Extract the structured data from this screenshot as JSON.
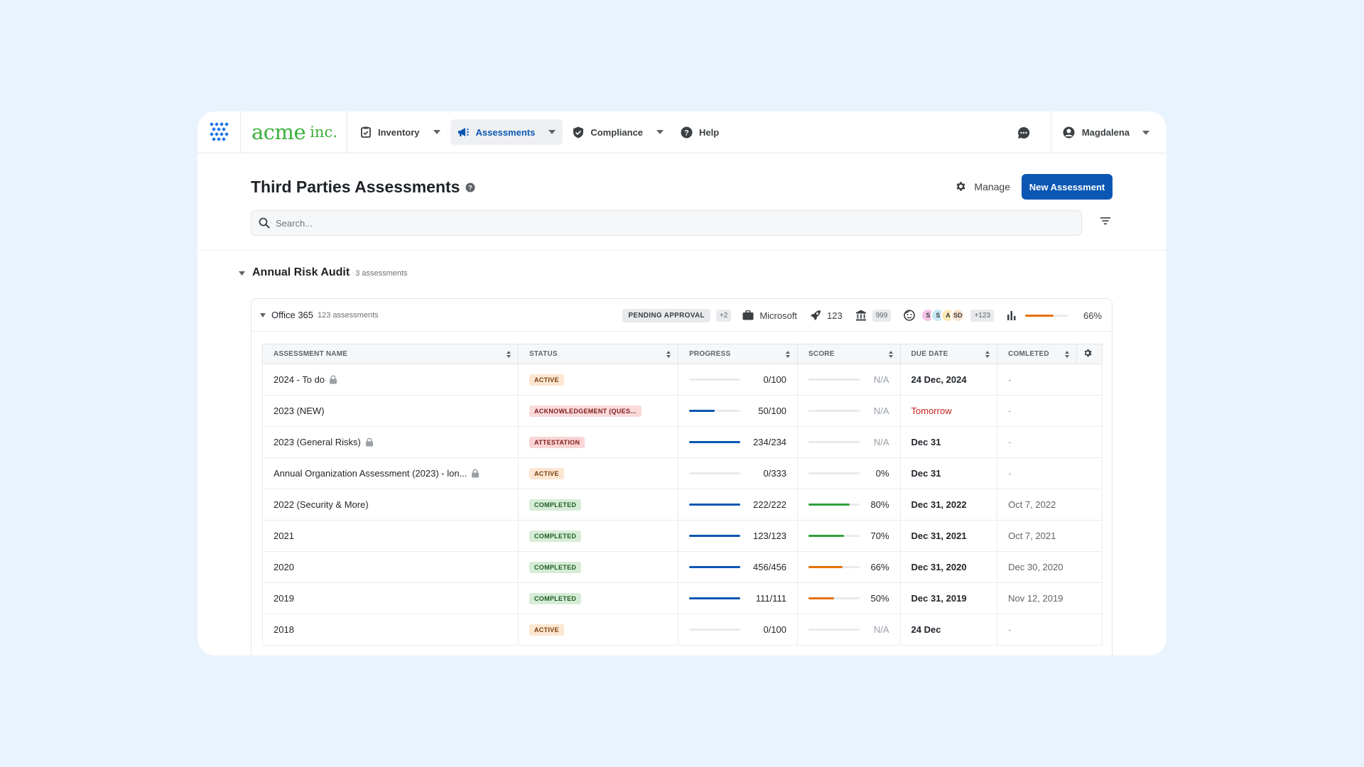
{
  "nav": {
    "brand_main": "acme",
    "brand_sub": "inc.",
    "items": [
      {
        "label": "Inventory",
        "icon": "clipboard-icon",
        "active": false,
        "dropdown": true
      },
      {
        "label": "Assessments",
        "icon": "megaphone-icon",
        "active": true,
        "dropdown": true
      },
      {
        "label": "Compliance",
        "icon": "shield-icon",
        "active": false,
        "dropdown": true
      },
      {
        "label": "Help",
        "icon": "help-icon",
        "active": false,
        "dropdown": false
      }
    ],
    "user_name": "Magdalena"
  },
  "header": {
    "title": "Third Parties Assessments",
    "manage_label": "Manage",
    "new_button_label": "New Assessment",
    "search_placeholder": "Search..."
  },
  "group": {
    "title": "Annual Risk Audit",
    "count": "3 assessments"
  },
  "card": {
    "title": "Office 365",
    "count": "123 assessments",
    "status_pill": "PENDING APPROVAL",
    "status_extra": "+2",
    "vendor": "Microsoft",
    "rocket_count": "123",
    "bank_count": "999",
    "avatars": [
      {
        "initials": "S",
        "color": "#f3c4e6"
      },
      {
        "initials": "S",
        "color": "#c6e7f5"
      },
      {
        "initials": "A",
        "color": "#fde8b8"
      },
      {
        "initials": "SD",
        "color": "#fbe3cf"
      }
    ],
    "avatar_extra": "+123",
    "score_percent": 66,
    "score_label": "66%"
  },
  "table": {
    "columns": [
      "ASSESSMENT NAME",
      "STATUS",
      "PROGRESS",
      "SCORE",
      "DUE DATE",
      "COMLETED"
    ],
    "rows": [
      {
        "name": "2024 - To do",
        "locked": true,
        "status": "ACTIVE",
        "status_kind": "active",
        "progress": "0/100",
        "progress_frac": 0,
        "score": "N/A",
        "score_frac": 0,
        "score_color": "green",
        "due": "24 Dec, 2024",
        "due_red": false,
        "completed": "-"
      },
      {
        "name": "2023 (NEW)",
        "locked": false,
        "status": "ACKNOWLEDGEMENT (QUES...",
        "status_kind": "ack",
        "progress": "50/100",
        "progress_frac": 0.5,
        "score": "N/A",
        "score_frac": 0,
        "score_color": "green",
        "due": "Tomorrow",
        "due_red": true,
        "completed": "-"
      },
      {
        "name": "2023 (General Risks)",
        "locked": true,
        "status": "ATTESTATION",
        "status_kind": "attest",
        "progress": "234/234",
        "progress_frac": 1,
        "score": "N/A",
        "score_frac": 0,
        "score_color": "green",
        "due": "Dec 31",
        "due_red": false,
        "completed": "-"
      },
      {
        "name": "Annual Organization Assessment (2023) - lon...",
        "locked": true,
        "status": "ACTIVE",
        "status_kind": "active",
        "progress": "0/333",
        "progress_frac": 0,
        "score": "0%",
        "score_frac": 0,
        "score_color": "green",
        "due": "Dec 31",
        "due_red": false,
        "completed": "-"
      },
      {
        "name": "2022 (Security & More)",
        "locked": false,
        "status": "COMPLETED",
        "status_kind": "completed",
        "progress": "222/222",
        "progress_frac": 1,
        "score": "80%",
        "score_frac": 0.8,
        "score_color": "green",
        "due": "Dec 31, 2022",
        "due_red": false,
        "completed": "Oct 7, 2022"
      },
      {
        "name": "2021",
        "locked": false,
        "status": "COMPLETED",
        "status_kind": "completed",
        "progress": "123/123",
        "progress_frac": 1,
        "score": "70%",
        "score_frac": 0.7,
        "score_color": "green",
        "due": "Dec 31, 2021",
        "due_red": false,
        "completed": "Oct 7, 2021"
      },
      {
        "name": "2020",
        "locked": false,
        "status": "COMPLETED",
        "status_kind": "completed",
        "progress": "456/456",
        "progress_frac": 1,
        "score": "66%",
        "score_frac": 0.66,
        "score_color": "orange",
        "due": "Dec 31, 2020",
        "due_red": false,
        "completed": "Dec 30, 2020"
      },
      {
        "name": "2019",
        "locked": false,
        "status": "COMPLETED",
        "status_kind": "completed",
        "progress": "111/111",
        "progress_frac": 1,
        "score": "50%",
        "score_frac": 0.5,
        "score_color": "orange",
        "due": "Dec 31, 2019",
        "due_red": false,
        "completed": "Nov 12, 2019"
      },
      {
        "name": "2018",
        "locked": false,
        "status": "ACTIVE",
        "status_kind": "active",
        "progress": "0/100",
        "progress_frac": 0,
        "score": "N/A",
        "score_frac": 0,
        "score_color": "green",
        "due": "24 Dec",
        "due_red": false,
        "completed": "-"
      }
    ]
  }
}
